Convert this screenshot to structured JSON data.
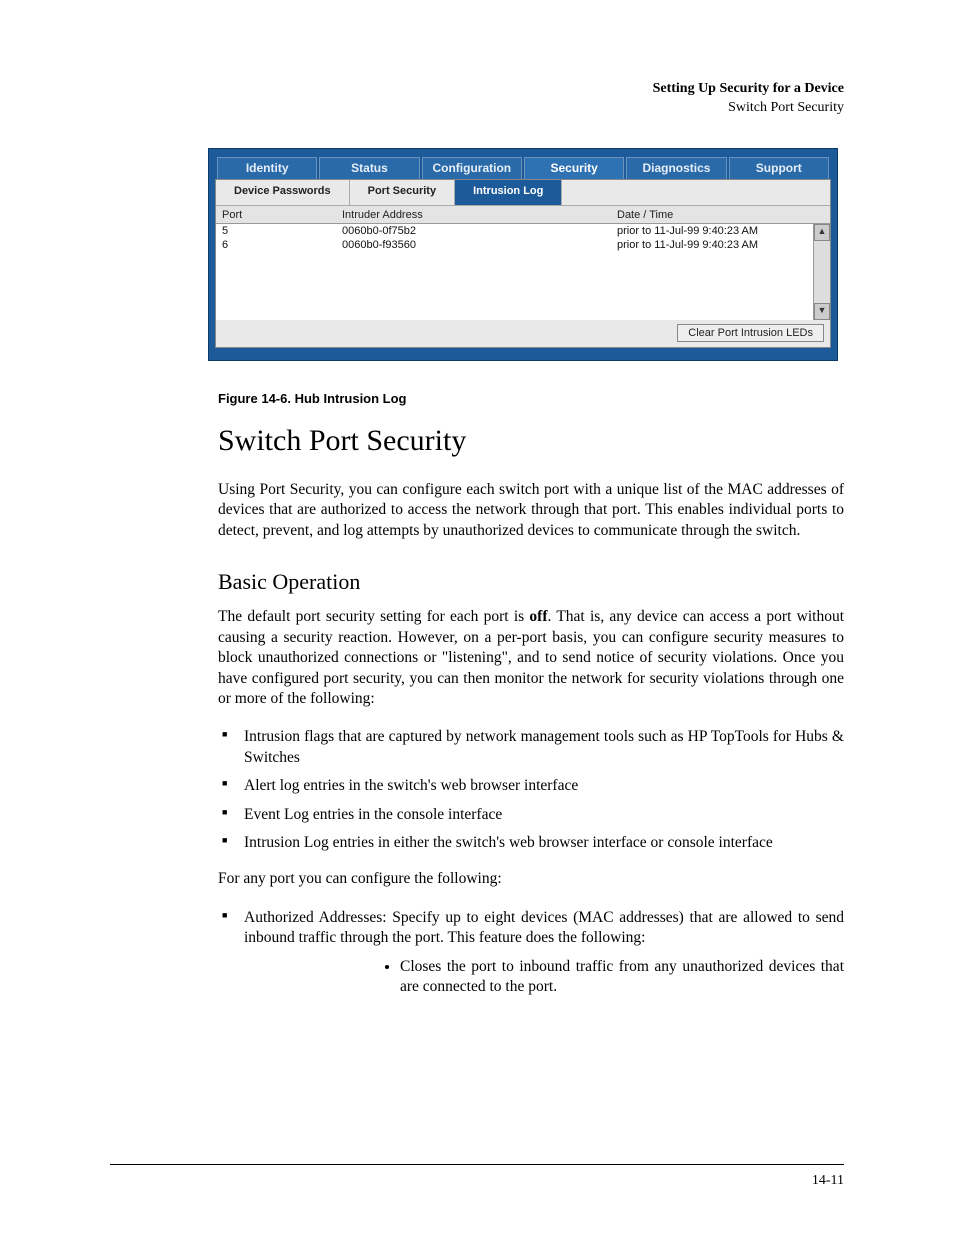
{
  "header": {
    "chapter": "Setting Up Security for a Device",
    "section": "Switch Port Security"
  },
  "ui": {
    "main_tabs": [
      "Identity",
      "Status",
      "Configuration",
      "Security",
      "Diagnostics",
      "Support"
    ],
    "main_tab_active_index": 3,
    "sub_tabs": [
      "Device Passwords",
      "Port Security",
      "Intrusion Log"
    ],
    "sub_tab_active_index": 2,
    "columns": {
      "port": "Port",
      "addr": "Intruder Address",
      "date": "Date / Time"
    },
    "rows": [
      {
        "port": "5",
        "addr": "0060b0-0f75b2",
        "date": "prior to 11-Jul-99 9:40:23 AM"
      },
      {
        "port": "6",
        "addr": "0060b0-f93560",
        "date": "prior to 11-Jul-99 9:40:23 AM"
      }
    ],
    "button": "Clear Port Intrusion LEDs"
  },
  "caption": "Figure 14-6.  Hub Intrusion Log",
  "h1": "Switch Port Security",
  "intro": "Using Port Security, you can configure each switch port with a unique list of the MAC addresses of devices that are authorized to access the network through that port. This enables individual ports to detect, prevent, and log attempts by unauthorized devices to communicate through the switch.",
  "h2": "Basic Operation",
  "basic_pre": "The default port security setting for each port is ",
  "basic_bold": "off",
  "basic_post": ". That is, any device can access a port without causing a security reaction. However, on a per-port basis, you can configure security measures to block unauthorized connections or \"listening\", and to send notice of security violations. Once you have configured port security, you can then monitor the network for security violations through one or more of the following:",
  "bullets1": [
    "Intrusion flags that are captured by network management tools such as HP TopTools for Hubs & Switches",
    "Alert log entries in the switch's web browser interface",
    "Event Log entries in the console interface",
    "Intrusion Log entries in either the switch's web browser interface or console interface"
  ],
  "config_intro": "For any port you can configure the following:",
  "bullets2": [
    "Authorized Addresses: Specify up to eight devices (MAC addresses) that are allowed to send inbound traffic through the port. This feature does the following:"
  ],
  "sub_bullets": [
    "Closes the port to inbound traffic from any unauthorized devices that are connected to the port."
  ],
  "page_number": "14-11"
}
